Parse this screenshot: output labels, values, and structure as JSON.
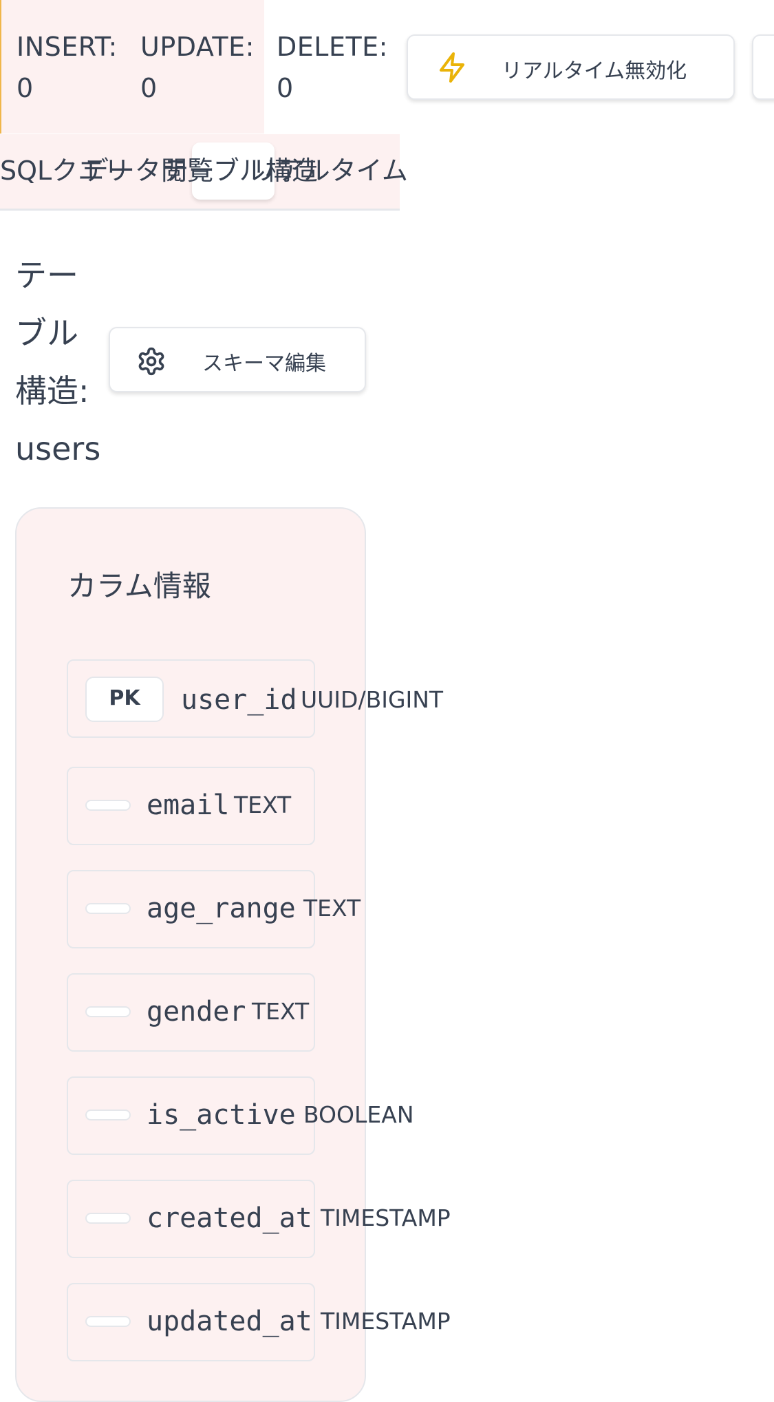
{
  "stats": {
    "insert": {
      "label": "INSERT:",
      "value": "0"
    },
    "update": {
      "label": "UPDATE:",
      "value": "0"
    },
    "delete": {
      "label": "DELETE:",
      "value": "0"
    }
  },
  "toolbar": {
    "realtime_button": {
      "label": "リアルタイム無効化",
      "icon": "lightning-icon"
    }
  },
  "tabs": [
    {
      "label": "SQLクエリ"
    },
    {
      "label": "データ閲覧"
    },
    {
      "label": "テーブル構造",
      "active": true
    },
    {
      "label": "リアルタイム"
    }
  ],
  "header": {
    "title": "テーブル構造: users",
    "schema_button": {
      "label": "スキーマ編集",
      "icon": "gear-icon"
    }
  },
  "columns_card": {
    "title": "カラム情報",
    "columns": [
      {
        "badge": "PK",
        "name": "user_id",
        "type": "UUID/BIGINT"
      },
      {
        "name": "email",
        "type": "TEXT"
      },
      {
        "name": "age_range",
        "type": "TEXT"
      },
      {
        "name": "gender",
        "type": "TEXT"
      },
      {
        "name": "is_active",
        "type": "BOOLEAN"
      },
      {
        "name": "created_at",
        "type": "TIMESTAMP"
      },
      {
        "name": "updated_at",
        "type": "TIMESTAMP"
      }
    ]
  },
  "colors": {
    "accent_yellow": "#eab308",
    "panel_bg": "#fdf1f1",
    "border": "#e5e7eb",
    "text": "#374151"
  }
}
